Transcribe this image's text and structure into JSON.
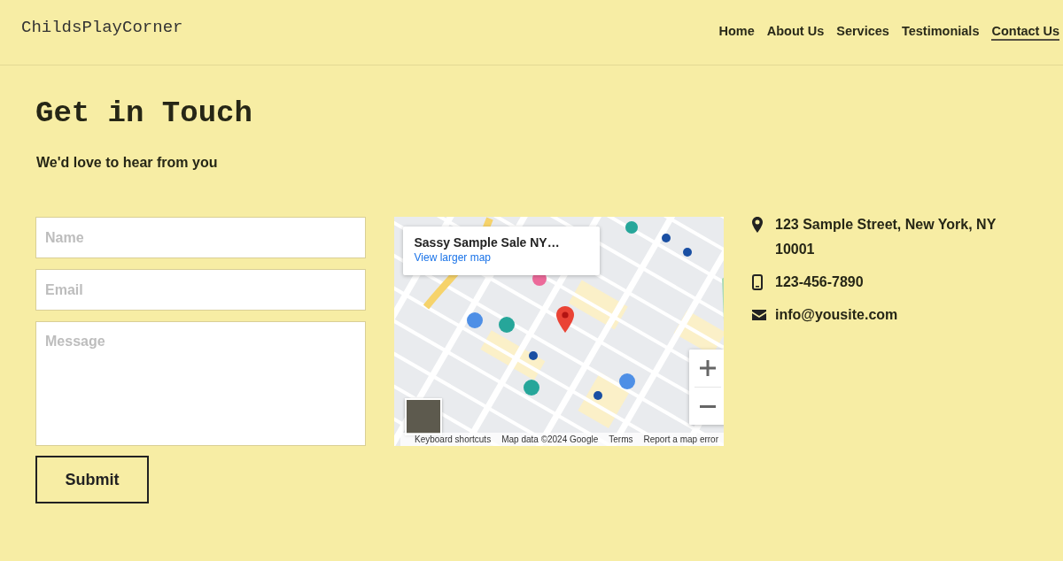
{
  "header": {
    "logo": "ChildsPlayCorner",
    "nav": [
      {
        "label": "Home",
        "selected": false
      },
      {
        "label": "About Us",
        "selected": false
      },
      {
        "label": "Services",
        "selected": false
      },
      {
        "label": "Testimonials",
        "selected": false
      },
      {
        "label": "Contact Us",
        "selected": true
      }
    ]
  },
  "contact": {
    "title": "Get in Touch",
    "subtitle": "We'd love to hear from you"
  },
  "form": {
    "fields": [
      {
        "kind": "input",
        "placeholder": "Name"
      },
      {
        "kind": "input",
        "placeholder": "Email"
      },
      {
        "kind": "textarea",
        "placeholder": "Message"
      }
    ],
    "submit": "Submit"
  },
  "map": {
    "place_card": {
      "title": "Sassy Sample Sale NY…",
      "link": "View larger map"
    },
    "footer": [
      "Keyboard shortcuts",
      "Map data ©2024 Google",
      "Terms",
      "Report a map error"
    ]
  },
  "info": [
    {
      "kind": "address",
      "text": "123 Sample Street, New York, NY 10001"
    },
    {
      "kind": "phone",
      "text": "123-456-7890"
    },
    {
      "kind": "email",
      "text": "info@yousite.com"
    }
  ]
}
